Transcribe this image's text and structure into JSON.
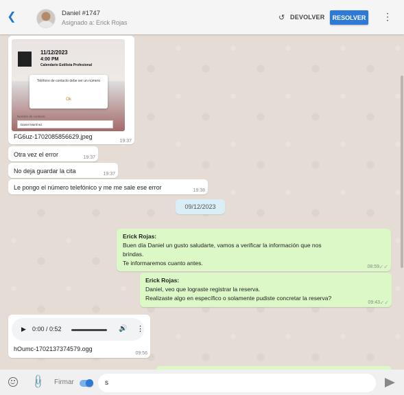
{
  "header": {
    "contact_name": "Daniel #1747",
    "assigned": "Asignado a: Erick Rojas",
    "return_label": "DEVOLVER",
    "resolve_label": "RESOLVER",
    "accent_color": "#2d7ad6"
  },
  "attachment_image": {
    "card_date": "11/12/2023",
    "card_time": "4:00 PM",
    "card_service": "Calendario Estilista Profesional",
    "dialog_text": "Teléfono de contacto debe ser un número",
    "dialog_ok": "Ok",
    "form_label": "Nombre de contacto",
    "form_value": "Daniel Martínez",
    "filename": "FG6uz-1702085856629.jpeg",
    "time": "19:37"
  },
  "messages_in": [
    {
      "text": "Otra vez el error",
      "time": "19:37"
    },
    {
      "text": "No deja guardar la cita",
      "time": "19:37"
    },
    {
      "text": "Le pongo el número telefónico y me me sale ese error",
      "time": "19:38"
    }
  ],
  "date_divider": "09/12/2023",
  "messages_out": [
    {
      "sender": "Erick Rojas:",
      "line1": "Buen día Daniel un gusto saludarte, vamos a verificar la información que nos",
      "line2": "brindas.",
      "line3": "Te informaremos cuanto antes.",
      "time": "08:59"
    },
    {
      "sender": "Erick Rojas:",
      "line1": "Daniel, veo que lograste registrar la reserva.",
      "line2": "Realizaste algo en específico o solamente pudiste concretar la reserva?",
      "time": "09:43"
    }
  ],
  "audio": {
    "time_display": "0:00 / 0:52",
    "filename": "hOumc-1702137374579.ogg",
    "time": "09:56"
  },
  "composer": {
    "sign_label": "Firmar",
    "value": "s"
  }
}
